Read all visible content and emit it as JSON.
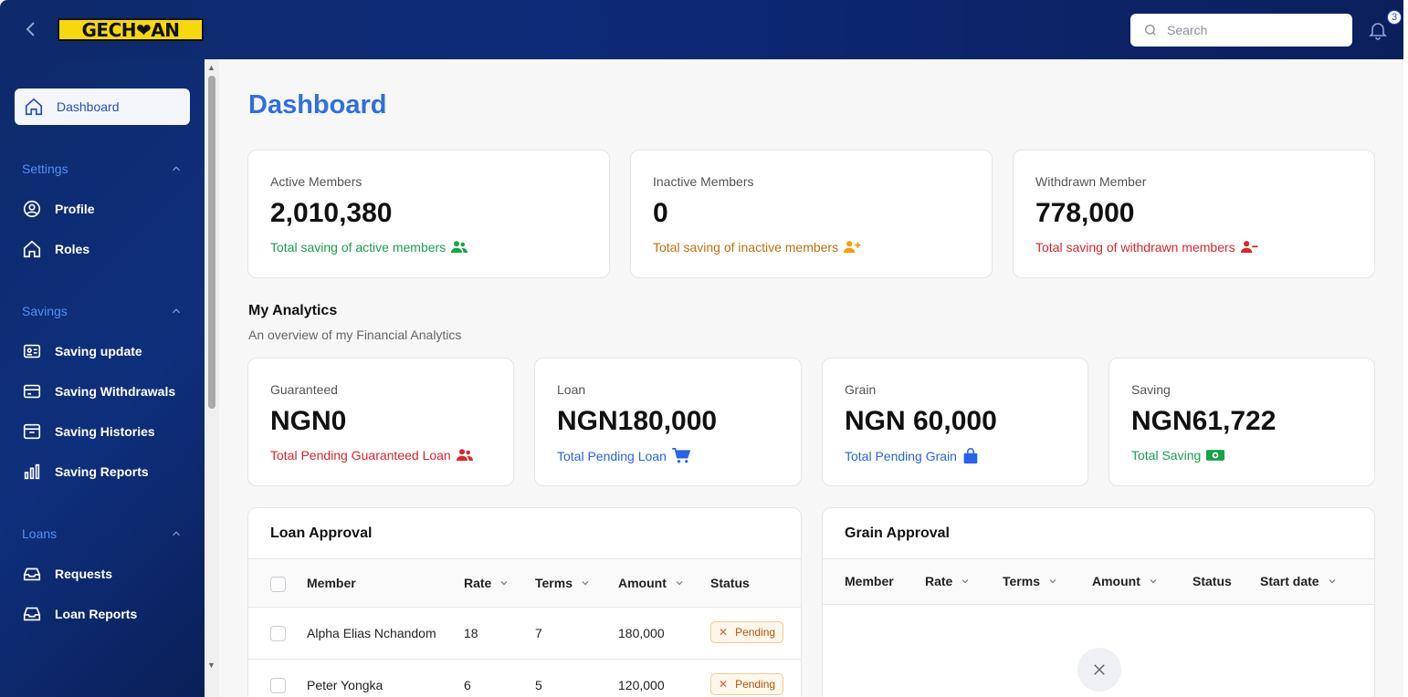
{
  "app": {
    "logo_text": "GECH❤AN"
  },
  "search": {
    "placeholder": "Search"
  },
  "notifications": {
    "count": "3"
  },
  "sidebar": {
    "active": "Dashboard",
    "sections": [
      {
        "title": "Settings",
        "items": [
          "Profile",
          "Roles"
        ]
      },
      {
        "title": "Savings",
        "items": [
          "Saving update",
          "Saving Withdrawals",
          "Saving Histories",
          "Saving Reports"
        ]
      },
      {
        "title": "Loans",
        "items": [
          "Requests",
          "Loan Reports"
        ]
      }
    ]
  },
  "page": {
    "title": "Dashboard"
  },
  "member_cards": [
    {
      "label": "Active Members",
      "value": "2,010,380",
      "sub": "Total saving of active members",
      "color": "#16a34a",
      "icon": "users-icon"
    },
    {
      "label": "Inactive Members",
      "value": "0",
      "sub": "Total saving of inactive members",
      "color": "#c2700c",
      "icon": "user-plus-icon"
    },
    {
      "label": "Withdrawn Member",
      "value": "778,000",
      "sub": "Total saving of withdrawn members",
      "color": "#dc2626",
      "icon": "user-minus-icon"
    }
  ],
  "analytics": {
    "title": "My Analytics",
    "subtitle": "An overview of my Financial Analytics",
    "cards": [
      {
        "label": "Guaranteed",
        "value": "NGN0",
        "sub": "Total Pending Guaranteed Loan",
        "color": "#dc2626",
        "icon": "users-icon"
      },
      {
        "label": "Loan",
        "value": "NGN180,000",
        "sub": "Total Pending Loan",
        "color": "#2563eb",
        "icon": "cart-icon"
      },
      {
        "label": "Grain",
        "value": "NGN 60,000",
        "sub": "Total Pending Grain",
        "color": "#2563eb",
        "icon": "shopping-bag-icon"
      },
      {
        "label": "Saving",
        "value": "NGN61,722",
        "sub": "Total Saving",
        "color": "#16a34a",
        "icon": "money-icon"
      }
    ]
  },
  "loan_approval": {
    "title": "Loan Approval",
    "columns": [
      "Member",
      "Rate",
      "Terms",
      "Amount",
      "Status"
    ],
    "rows": [
      {
        "member": "Alpha Elias Nchandom",
        "rate": "18",
        "terms": "7",
        "amount": "180,000",
        "status": "Pending"
      },
      {
        "member": "Peter Yongka",
        "rate": "6",
        "terms": "5",
        "amount": "120,000",
        "status": "Pending"
      }
    ]
  },
  "grain_approval": {
    "title": "Grain Approval",
    "columns": [
      "Member",
      "Rate",
      "Terms",
      "Amount",
      "Status",
      "Start date"
    ]
  },
  "colors": {
    "accent": "#2f6fe0",
    "sidebar": "#0e2a6b"
  }
}
